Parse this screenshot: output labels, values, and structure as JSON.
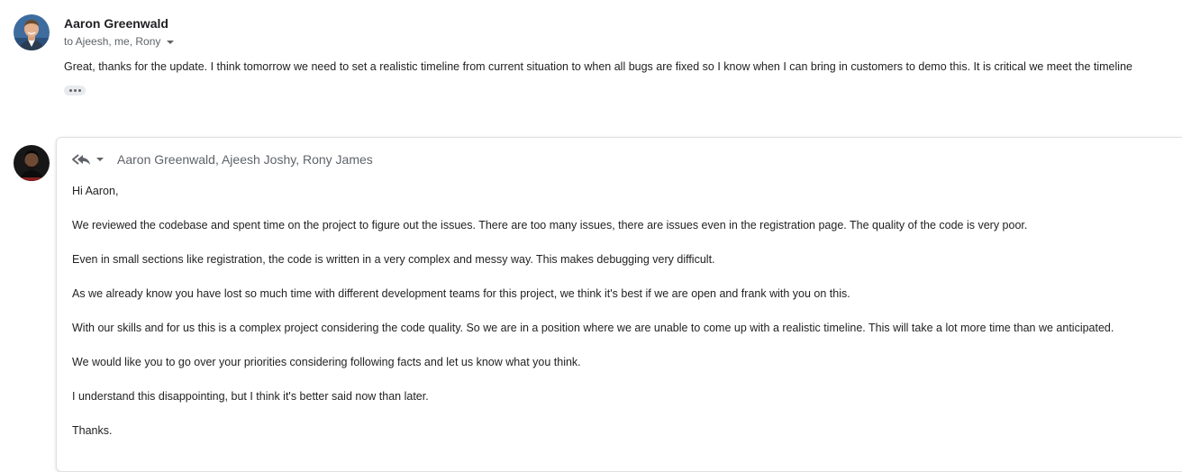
{
  "thread": {
    "message1": {
      "sender": "Aaron Greenwald",
      "recipients": "to Ajeesh, me, Rony",
      "body": "Great, thanks for the update.  I think tomorrow we need to set a realistic timeline from current situation to when all bugs are fixed so I know when I can bring in customers to demo this.  It is critical we meet the timeline"
    },
    "reply": {
      "recipients": "Aaron Greenwald, Ajeesh Joshy, Rony James",
      "paragraphs": [
        "Hi Aaron,",
        "We reviewed the codebase and spent time on the project to figure out the issues. There are too many issues, there are issues even in the registration page. The quality of the code is very poor.",
        "Even in small sections like registration, the code is written in a very complex and messy way. This makes debugging very difficult.",
        "As we already know you have lost so much time with different development teams for this project, we think it's best if we are open and frank with you on this.",
        "With our skills and for us this is a complex project considering the code quality. So we are in a position where we are unable to come up with a realistic timeline. This will take a lot more time than we anticipated.",
        "We would like you to go over your priorities considering following facts and let us know what you think.",
        "I understand this disappointing, but I think it's better said now than later.",
        "Thanks."
      ]
    }
  },
  "icons": {
    "avatar_sender": "avatar-photo",
    "avatar_me": "avatar-photo-dark",
    "show_details": "chevron-down-icon",
    "trimmed_content": "ellipsis-icon",
    "reply_type": "reply-all-icon"
  }
}
